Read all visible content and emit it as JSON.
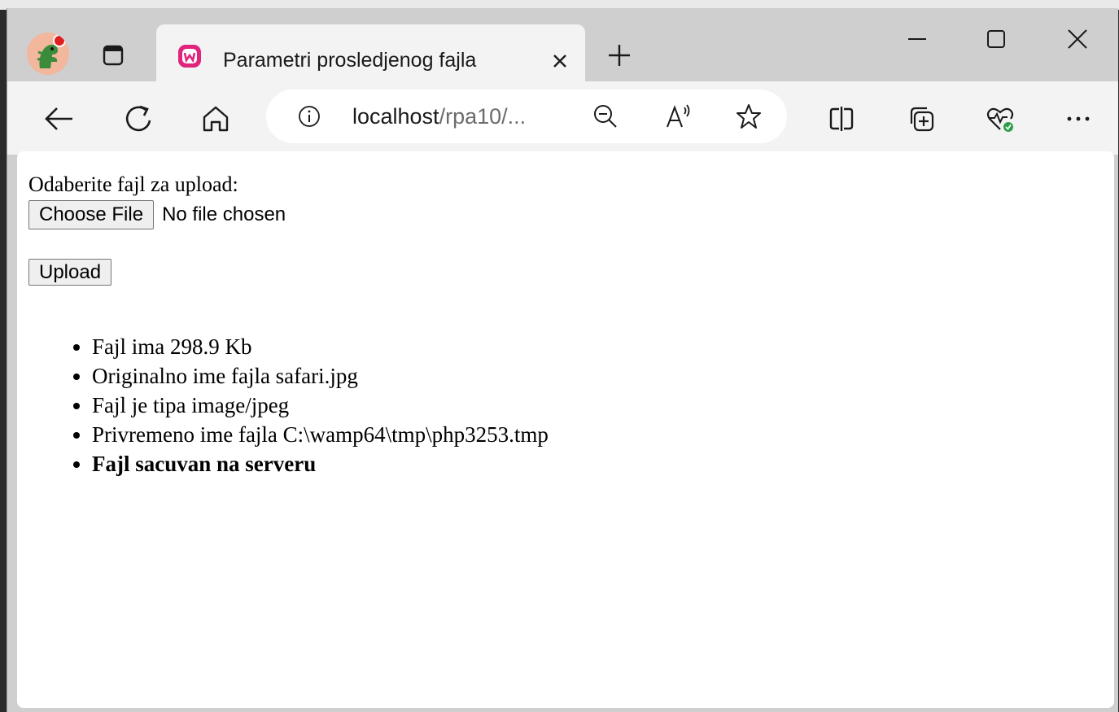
{
  "browser": {
    "tab_title": "Parametri prosledjenog fajla",
    "address": {
      "host": "localhost",
      "path": "/rpa10/..."
    },
    "icons": {
      "profile": "dinosaur-avatar-icon",
      "tab_actions": "tab-actions-icon",
      "favicon": "wampserver-icon",
      "tab_close": "close-icon",
      "new_tab": "plus-icon",
      "minimize": "minimize-icon",
      "maximize": "maximize-icon",
      "close_window": "close-icon",
      "back": "back-arrow-icon",
      "refresh": "refresh-icon",
      "home": "home-icon",
      "site_info": "info-icon",
      "zoom": "zoom-out-icon",
      "read_aloud": "read-aloud-icon",
      "favorite": "star-icon",
      "split_screen": "split-screen-icon",
      "collections": "collections-icon",
      "browser_essentials": "heart-pulse-icon",
      "more": "more-icon"
    },
    "colors": {
      "tabbar": "#cfcfcf",
      "toolbar": "#f3f3f3",
      "favicon": "#e0237b"
    }
  },
  "page": {
    "prompt": "Odaberite fajl za upload:",
    "choose_file_label": "Choose File",
    "file_status": "No file chosen",
    "upload_label": "Upload",
    "results": [
      "Fajl ima 298.9 Kb",
      "Originalno ime fajla safari.jpg",
      "Fajl je tipa image/jpeg",
      "Privremeno ime fajla C:\\wamp64\\tmp\\php3253.tmp",
      "Fajl sacuvan na serveru"
    ]
  }
}
